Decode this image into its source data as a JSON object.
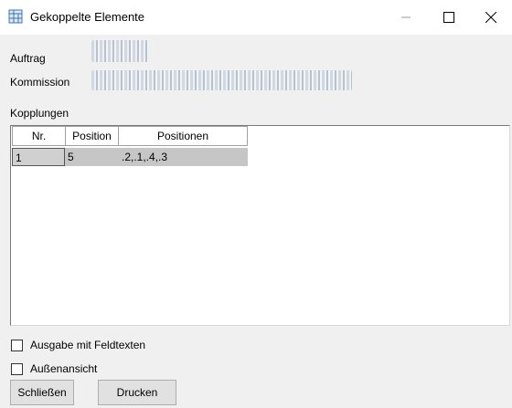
{
  "window": {
    "title": "Gekoppelte Elemente",
    "icon": "grid-window-icon",
    "controls": {
      "minimize": "—",
      "maximize": "☐",
      "close": "✕"
    }
  },
  "fields": {
    "auftrag_label": "Auftrag",
    "kommission_label": "Kommission"
  },
  "kopplungen_label": "Kopplungen",
  "table": {
    "columns": [
      "Nr.",
      "Position",
      "Positionen"
    ],
    "rows": [
      {
        "nr": "1",
        "position": "5",
        "positionen": ".2,.1,.4,.3"
      }
    ]
  },
  "options": {
    "ausgabe_label": "Ausgabe mit Feldtexten",
    "aussenansicht_label": "Außenansicht"
  },
  "buttons": {
    "close": "Schließen",
    "print": "Drucken"
  }
}
